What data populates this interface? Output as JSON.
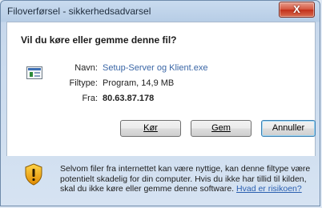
{
  "window": {
    "title": "Filoverførsel - sikkerhedsadvarsel",
    "close_label": "X"
  },
  "dialog": {
    "question": "Vil du køre eller gemme denne fil?",
    "file_icon": "program-file-icon",
    "fields": {
      "name_label": "Navn:",
      "name_value": "Setup-Server og Klient.exe",
      "type_label": "Filtype:",
      "type_value": "Program, 14,9 MB",
      "from_label": "Fra:",
      "from_value": "80.63.87.178"
    },
    "buttons": {
      "run": "Kør",
      "save": "Gem",
      "cancel": "Annuller"
    }
  },
  "warning": {
    "icon": "security-shield-icon",
    "text": "Selvom filer fra internettet kan være nyttige, kan denne filtype være potentielt skadelig for din computer. Hvis du ikke har tillid til kilden, skal du ikke køre eller gemme denne software.",
    "link": "Hvad er risikoen?"
  }
}
